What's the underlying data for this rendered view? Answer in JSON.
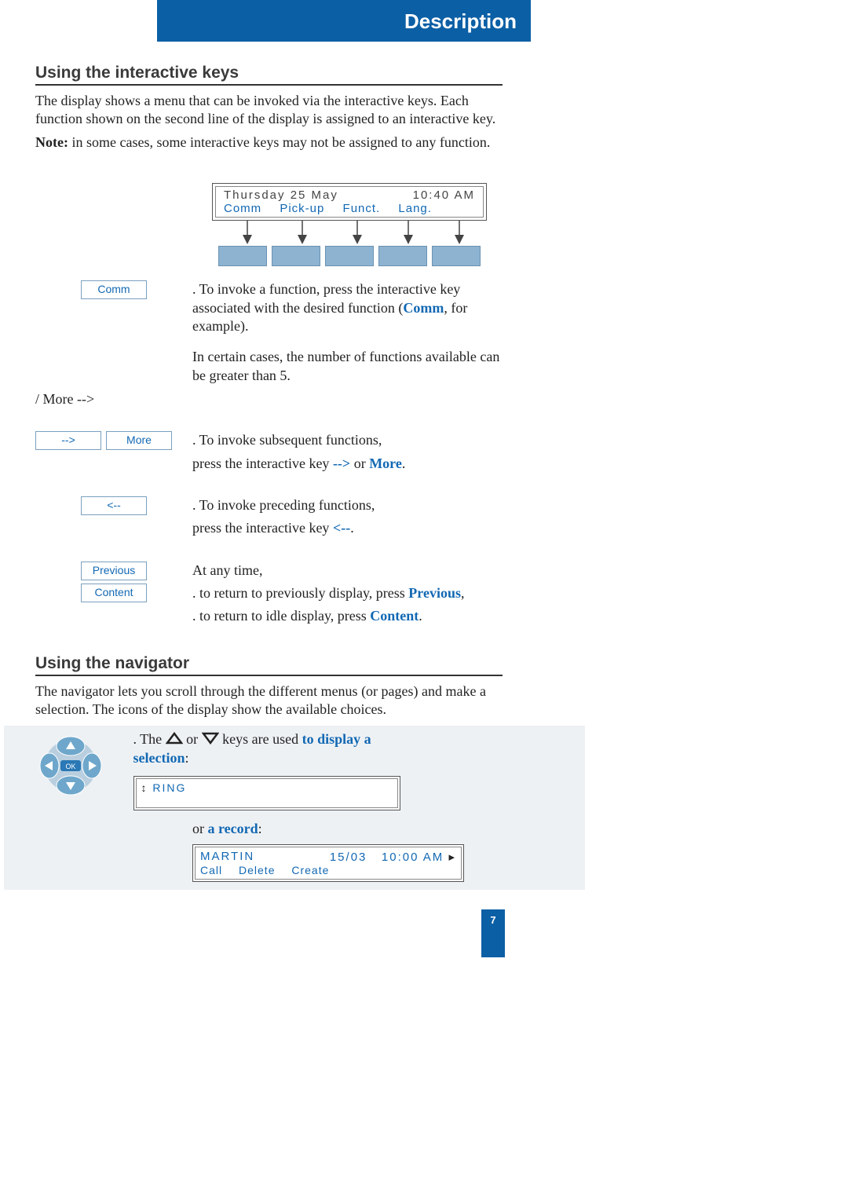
{
  "header": {
    "title": "Description"
  },
  "section1": {
    "title": "Using the interactive keys",
    "intro": "The display shows a menu that can be invoked via the interactive keys. Each function shown on the second line of the display is assigned to an interactive key.",
    "note_label": "Note:",
    "note_text": " in some cases, some interactive keys may not be assigned to any function."
  },
  "display": {
    "date": "Thursday 25 May",
    "time": "10:40 AM",
    "fns": {
      "a": "Comm",
      "b": "Pick-up",
      "c": "Funct.",
      "d": "Lang."
    }
  },
  "keys": {
    "comm": "Comm",
    "arrow_next": "-->",
    "more": "More",
    "arrow_prev": "<--",
    "previous": "Previous",
    "content": "Content"
  },
  "body": {
    "invoke_a": ". To invoke a function, press the interactive key associated with the desired function (",
    "invoke_b": "Comm",
    "invoke_c": ", for example).",
    "gt5": "In certain cases, the number of functions available can be greater than 5.",
    "subseq_a": ". To invoke subsequent functions,",
    "subseq_b_pre": "press the interactive key ",
    "subseq_arrow": "-->",
    "subseq_or": " or ",
    "subseq_more": "More",
    "preced_a": ". To invoke preceding functions,",
    "preced_b_pre": "press the interactive key ",
    "preced_arrow": "<--",
    "anytime": "At any time,",
    "ret_prev_a": ". to return to previously display, press ",
    "ret_prev_b": "Previous",
    "ret_idle_a": ". to return to idle display, press ",
    "ret_idle_b": "Content"
  },
  "section2": {
    "title": "Using the navigator",
    "intro": "The navigator lets you scroll through the different menus (or pages) and make a selection. The icons of the display show the available choices.",
    "line_a": ". The ",
    "line_b": " or ",
    "line_c": " keys are used ",
    "line_bold": "to display a selection",
    "ring": "RING",
    "or_record_a": "or ",
    "or_record_b": "a record"
  },
  "record": {
    "name": "MARTIN",
    "date": "15/03",
    "time": "10:00 AM",
    "fns": {
      "a": "Call",
      "b": "Delete",
      "c": "Create"
    }
  },
  "page_number": "7"
}
